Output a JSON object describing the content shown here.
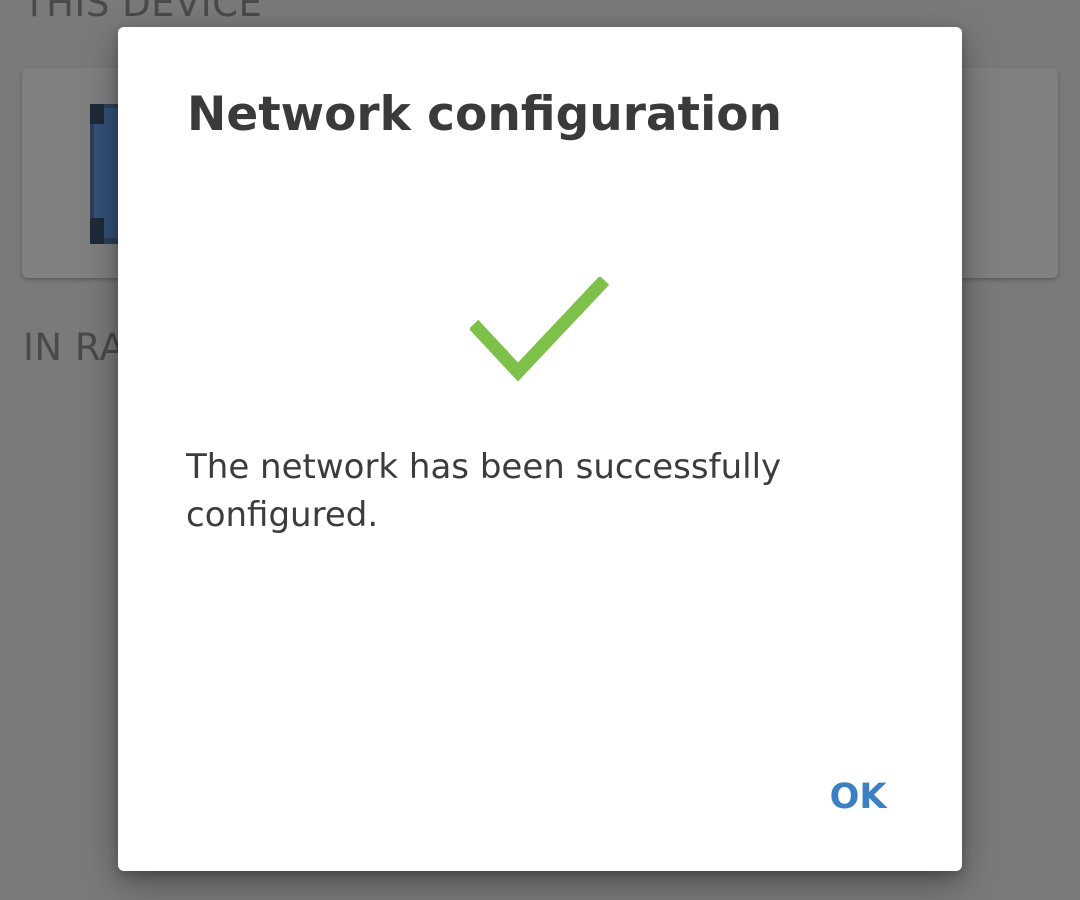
{
  "background": {
    "section_this_device": "THIS DEVICE",
    "section_in_range": "IN RA"
  },
  "dialog": {
    "title": "Network configuration",
    "icon": "checkmark-icon",
    "icon_color": "#7dc14b",
    "message": "The network has been successfully configured.",
    "ok_label": "OK",
    "ok_color": "#3c7fc2"
  }
}
